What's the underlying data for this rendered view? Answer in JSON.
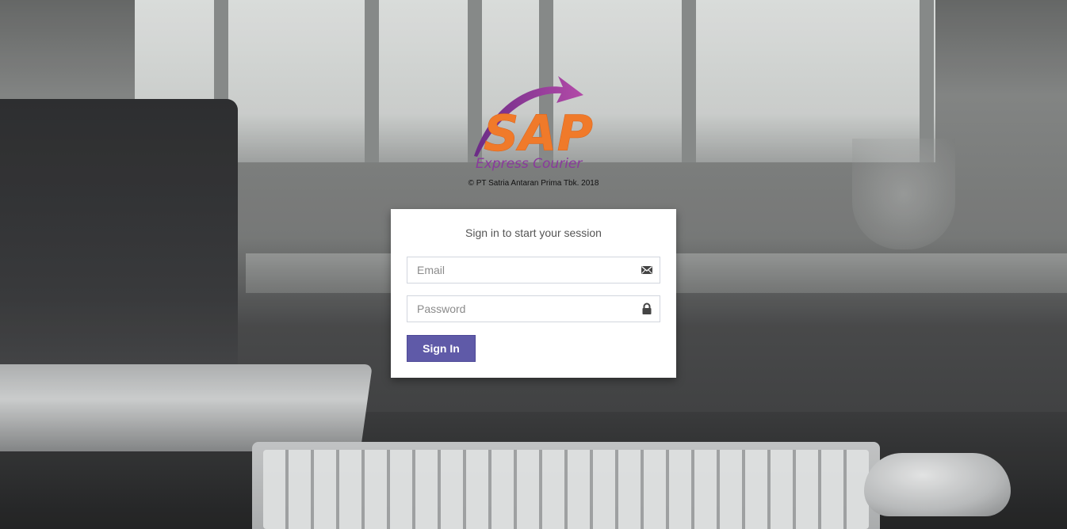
{
  "brand": {
    "logo_word": "SAP",
    "logo_tagline": "Express Courier",
    "copyright": "© PT Satria Antaran Prima Tbk.  2018"
  },
  "login": {
    "message": "Sign in to start your session",
    "email": {
      "placeholder": "Email",
      "value": "",
      "icon": "envelope-icon"
    },
    "password": {
      "placeholder": "Password",
      "value": "",
      "icon": "lock-icon"
    },
    "submit_label": "Sign In"
  },
  "colors": {
    "accent": "#5f5aa8",
    "logo_orange": "#f07a2a",
    "logo_purple": "#8a3a9c"
  }
}
